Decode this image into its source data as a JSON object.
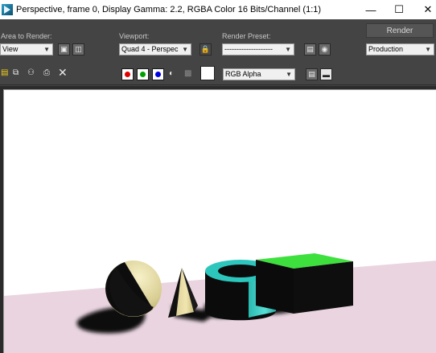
{
  "window": {
    "title": "Perspective, frame 0, Display Gamma: 2.2, RGBA Color 16 Bits/Channel (1:1)",
    "minimize_glyph": "—",
    "maximize_glyph": "☐",
    "close_glyph": "✕"
  },
  "toolbar": {
    "area_label": "Area to Render:",
    "area_value": "View",
    "viewport_label": "Viewport:",
    "viewport_value": "Quad 4 - Perspec",
    "preset_label": "Render Preset:",
    "preset_value": "--------------------",
    "render_label": "Render",
    "mode_value": "Production",
    "channel_value": "RGB Alpha",
    "clear_glyph": "✕"
  },
  "colors": {
    "red_channel": "#e00000",
    "green_channel": "#00a000",
    "blue_channel": "#0000e0",
    "floor": "#e9d4e0",
    "box_top": "#3de03d",
    "torus_side": "#37c9c0",
    "background": "#ffffff"
  },
  "icons": [
    "app-icon",
    "crop-icon",
    "region-icon",
    "lock-icon",
    "preset-save-icon",
    "preset-load-icon",
    "save-image-icon",
    "copy-image-icon",
    "clone-window-icon",
    "print-icon",
    "clear-icon",
    "alpha-channel-icon",
    "mono-icon",
    "display-toggle-icon",
    "frame-window-icon"
  ]
}
